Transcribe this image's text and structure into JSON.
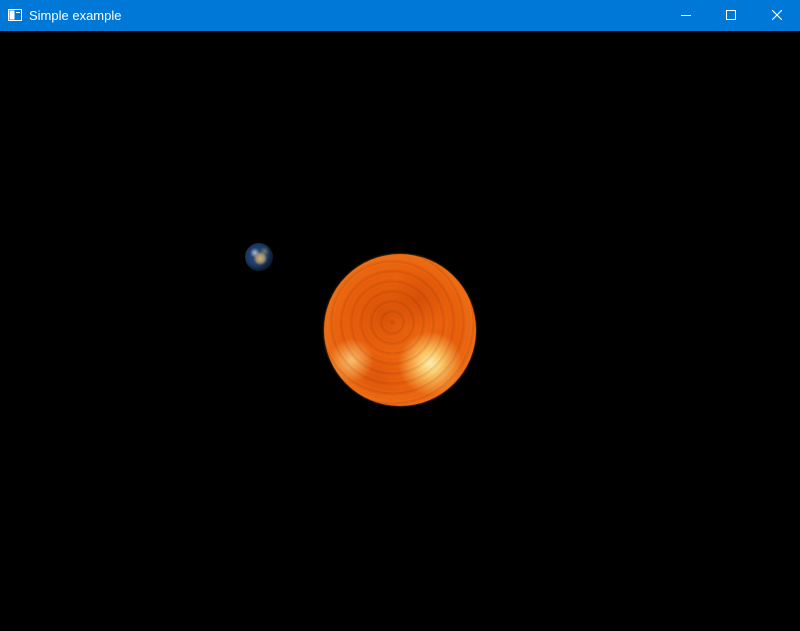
{
  "window": {
    "title": "Simple example",
    "background_color": "#000000",
    "titlebar_color": "#0078d7"
  },
  "titlebar": {
    "app_icon": "window-app-icon",
    "minimize_icon": "minimize-icon",
    "maximize_icon": "maximize-icon",
    "close_icon": "close-icon"
  },
  "scene": {
    "objects": [
      {
        "name": "sun",
        "colors": [
          "#e8620c",
          "#f8b25e"
        ]
      },
      {
        "name": "earth",
        "colors": [
          "#1d3a66",
          "#d6b482"
        ]
      }
    ]
  }
}
